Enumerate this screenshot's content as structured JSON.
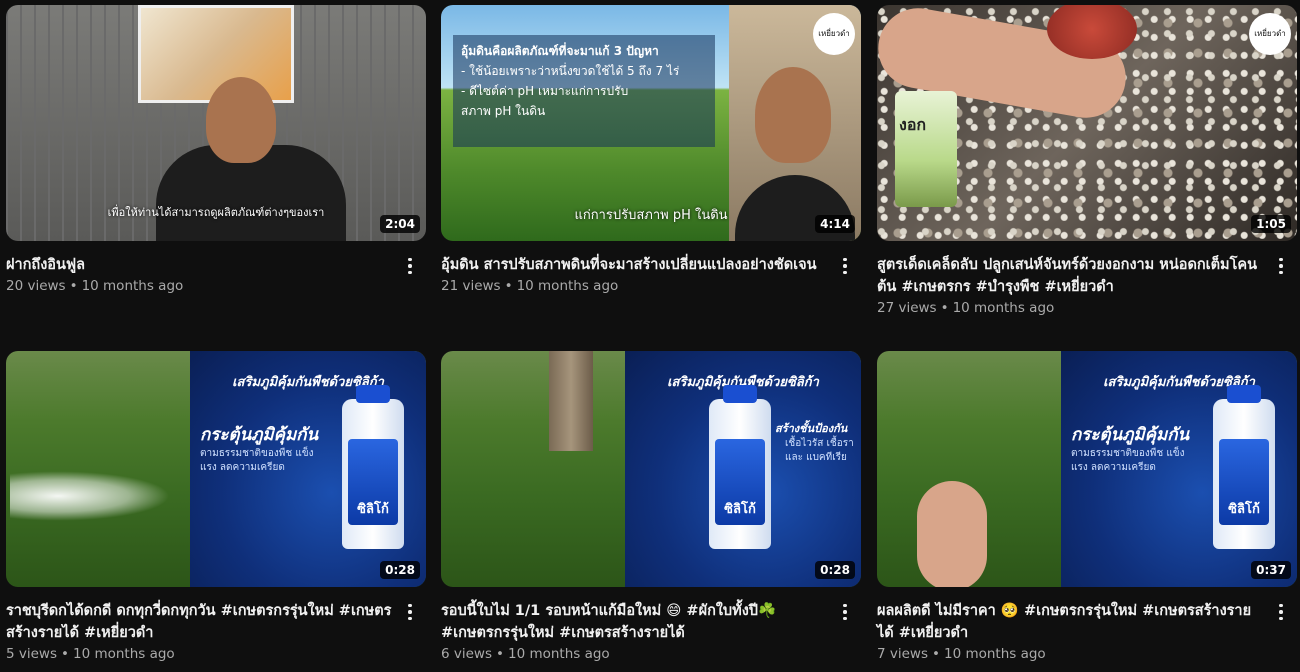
{
  "videos": [
    {
      "title": "ฝากถึงอินฟูล",
      "views": "20 views",
      "age": "10 months ago",
      "duration": "2:04",
      "thumb_caption": "เพื่อให้ท่านได้สามารถดูผลิตภัณฑ์ต่างๆของเรา"
    },
    {
      "title": "อุ้มดิน สารปรับสภาพดินที่จะมาสร้างเปลี่ยนแปลงอย่างชัดเจน",
      "views": "21 views",
      "age": "10 months ago",
      "duration": "4:14",
      "thumb_lines": [
        "อุ้มดินคือผลิตภัณฑ์ที่จะมาแก้ 3 ปัญหา",
        "- ใช้น้อยเพราะว่าหนึ่งขวดใช้ได้ 5 ถึง 7 ไร่",
        "- ดีไซต์ค่า pH เหมาะแก่การปรับ",
        "สภาพ pH ในดิน"
      ],
      "thumb_caption": "แก่การปรับสภาพ pH ในดิน",
      "thumb_logo": "เหยี่ยวดำ"
    },
    {
      "title": "สูตรเด็ดเคล็ดลับ ปลูกเสน่ห์จันทร์ด้วยงอกงาม หน่อดกเต็มโคนต้น #เกษตรกร #บำรุงพืช #เหยี่ยวดำ",
      "views": "27 views",
      "age": "10 months ago",
      "duration": "1:05",
      "thumb_bag": "งอก",
      "thumb_logo": "เหยี่ยวดำ"
    },
    {
      "title": "ราชบุรีดกได้ดกดี ดกทุกวี่ดกทุกวัน #เกษตรกรรุ่นใหม่ #เกษตรสร้างรายได้ #เหยี่ยวดำ",
      "views": "5 views",
      "age": "10 months ago",
      "duration": "0:28",
      "promo_head": "เสริมภูมิคุ้มกันพืชด้วยซิลิก้า",
      "promo_big": "กระตุ้นภูมิคุ้มกัน",
      "promo_small": "ตามธรรมชาติของพืช แข็งแรง ลดความเครียด",
      "bottle_label": "ซิลิโก้"
    },
    {
      "title": "รอบนี้ใบไม่ 1/1 รอบหน้าแก้มือใหม่ 😄 #ผักใบทั้งปี☘️ #เกษตรกรรุ่นใหม่ #เกษตรสร้างรายได้",
      "views": "6 views",
      "age": "10 months ago",
      "duration": "0:28",
      "promo_head": "เสริมภูมิคุ้มกันพืชด้วยซิลิก้า",
      "promo_big": "สร้างชั้นป้องกัน",
      "promo_small": "เชื้อไวรัส เชื้อรา และ แบคทีเรีย",
      "bottle_label": "ซิลิโก้"
    },
    {
      "title": "ผลผลิตดี ไม่มีราคา 🥺 #เกษตรกรรุ่นใหม่ #เกษตรสร้างรายได้ #เหยี่ยวดำ",
      "views": "7 views",
      "age": "10 months ago",
      "duration": "0:37",
      "promo_head": "เสริมภูมิคุ้มกันพืชด้วยซิลิก้า",
      "promo_big": "กระตุ้นภูมิคุ้มกัน",
      "promo_small": "ตามธรรมชาติของพืช แข็งแรง ลดความเครียด",
      "bottle_label": "ซิลิโก้"
    }
  ]
}
